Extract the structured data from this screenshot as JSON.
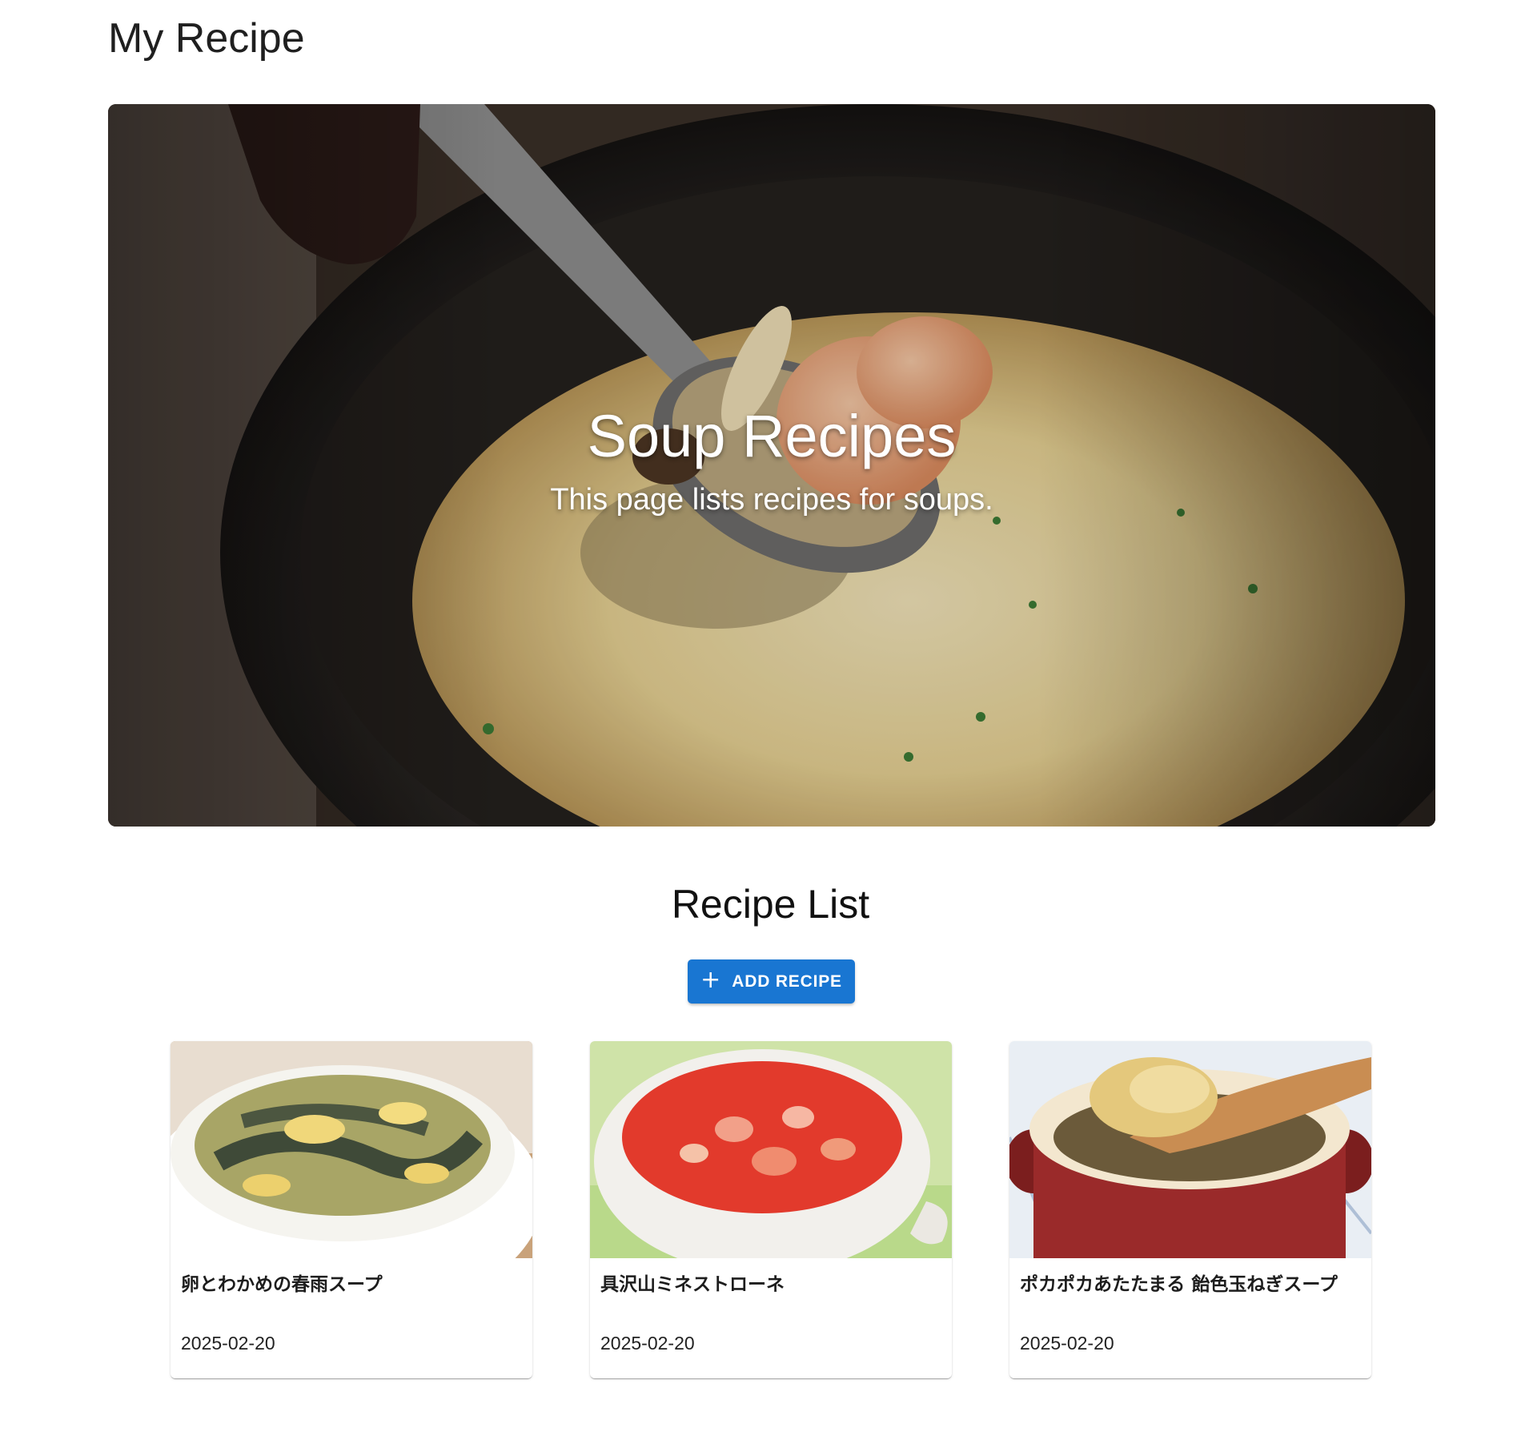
{
  "header": {
    "app_title": "My Recipe"
  },
  "hero": {
    "title": "Soup Recipes",
    "subtitle": "This page lists recipes for soups."
  },
  "recipe_list": {
    "title": "Recipe List",
    "add_button": {
      "icon": "plus-icon",
      "label": "ADD RECIPE"
    },
    "recipes": [
      {
        "name": "卵とわかめの春雨スープ",
        "date": "2025-02-20"
      },
      {
        "name": "具沢山ミネストローネ",
        "date": "2025-02-20"
      },
      {
        "name": "ポカポカあたたまる 飴色玉ねぎスープ",
        "date": "2025-02-20"
      }
    ]
  },
  "colors": {
    "primary": "#1976d2",
    "text": "#1f1f1f",
    "background": "#ffffff"
  }
}
